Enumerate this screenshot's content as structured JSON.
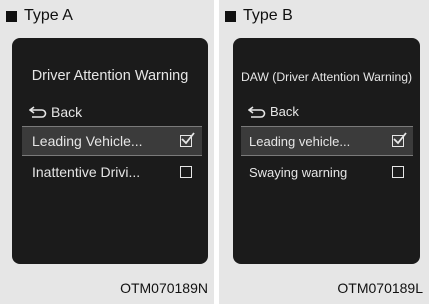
{
  "panel_a": {
    "type_label": "Type A",
    "title": "Driver Attention Warning",
    "back_label": "Back",
    "items": [
      {
        "label": "Leading Vehicle...",
        "checked": true
      },
      {
        "label": "Inattentive Drivi...",
        "checked": false
      }
    ],
    "code": "OTM070189N"
  },
  "panel_b": {
    "type_label": "Type B",
    "title": "DAW (Driver Attention Warning)",
    "back_label": "Back",
    "items": [
      {
        "label": "Leading vehicle...",
        "checked": true
      },
      {
        "label": "Swaying warning",
        "checked": false
      }
    ],
    "code": "OTM070189L"
  }
}
